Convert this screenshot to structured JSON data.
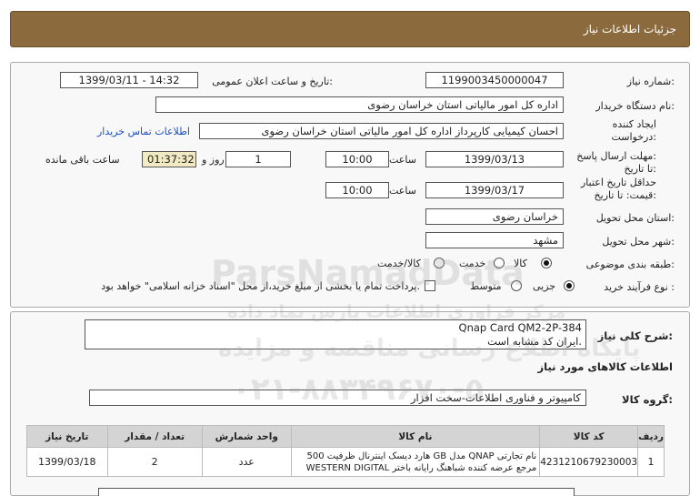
{
  "header": {
    "title": "جزئیات اطلاعات نیاز"
  },
  "form": {
    "need_number_label": "شماره نیاز:",
    "need_number": "1199003450000047",
    "announce_label": "تاریخ و ساعت اعلان عمومی:",
    "announce_value": "1399/03/11 - 14:32",
    "buyer_label": "نام دستگاه خریدار:",
    "buyer_value": "اداره کل امور مالیاتی استان خراسان رضوی",
    "creator_label_1": "ایجاد کننده",
    "creator_label_2": "درخواست:",
    "creator_value": "احسان کیمیایی کارپرداز اداره کل امور مالیاتی استان خراسان رضوی",
    "contact_link": "اطلاعات تماس خریدار",
    "deadline_label_1": "مهلت ارسال پاسخ:",
    "deadline_label_2": "تا تاریخ:",
    "deadline_date": "1399/03/13",
    "time_label": "ساعت",
    "deadline_time": "10:00",
    "days_value": "1",
    "days_label": "روز و",
    "remaining_time": "01:37:32",
    "remaining_label": "ساعت باقی مانده",
    "validity_label_1": "حداقل تاریخ اعتبار",
    "validity_label_2": "قیمت: تا تاریخ:",
    "validity_date": "1399/03/17",
    "validity_time": "10:00",
    "province_label": "استان محل تحویل:",
    "province_value": "خراسان رضوی",
    "city_label": "شهر محل تحویل:",
    "city_value": "مشهد",
    "category_label": "طبقه بندی موضوعی:",
    "category_options": [
      "کالا",
      "خدمت",
      "کالا/خدمت"
    ],
    "process_label": "نوع فرآیند خرید :",
    "process_options": [
      "جزیی",
      "متوسط"
    ],
    "payment_note": "پرداخت تمام یا بخشی از مبلغ خرید،از محل \"اسناد خزانه اسلامی\" خواهد بود."
  },
  "summary": {
    "label": "شرح کلی نیاز:",
    "line1": "Qnap Card QM2-2P-384",
    "line2": "ایران کد مشابه است."
  },
  "goods": {
    "section_title": "اطلاعات کالاهای مورد نیاز",
    "group_label": "گروه کالا:",
    "group_value": "کامپیوتر و فناوری اطلاعات-سخت افزار",
    "columns": [
      "ردیف",
      "کد کالا",
      "نام کالا",
      "واحد شمارش",
      "تعداد / مقدار",
      "تاریخ نیاز"
    ],
    "rows": [
      {
        "index": "1",
        "code": "4231210679230003",
        "name_1": "هارد دیسک اینترنال ظرفیت 500 GB مدل QNAP نام تجارتی",
        "name_2": "WESTERN DIGITAL مرجع عرضه کننده شباهنگ رایانه باختر",
        "unit": "عدد",
        "qty": "2",
        "date": "1399/03/18"
      }
    ]
  },
  "watermark": {
    "line1": "ParsNamadData",
    "line2": "مرکز فراوری اطلاعات پارس نماد داده",
    "line3": "پایگاه اطلاع رسانی مناقصه و مزایده",
    "line4": "۰۲۱-۸۸۳۴۹۶۷۰-۵"
  }
}
